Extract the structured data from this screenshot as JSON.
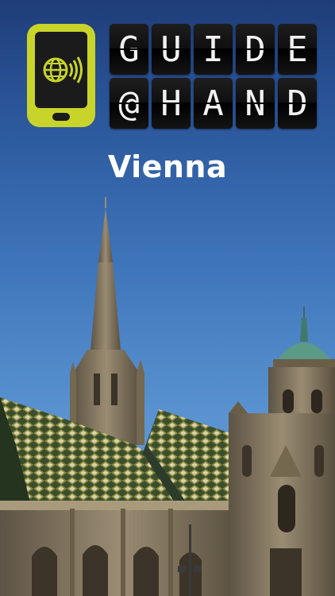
{
  "brand": {
    "row1": [
      "G",
      "U",
      "I",
      "D",
      "E"
    ],
    "row2": [
      "@",
      "H",
      "A",
      "N",
      "D"
    ],
    "logo_icon": "phone-globe-signal-icon",
    "logo_color": "#c8d42a"
  },
  "city": {
    "title": "Vienna"
  },
  "colors": {
    "sky_top": "#1f3d78",
    "sky_bottom": "#6aa3da",
    "stone": "#8a7c64"
  }
}
